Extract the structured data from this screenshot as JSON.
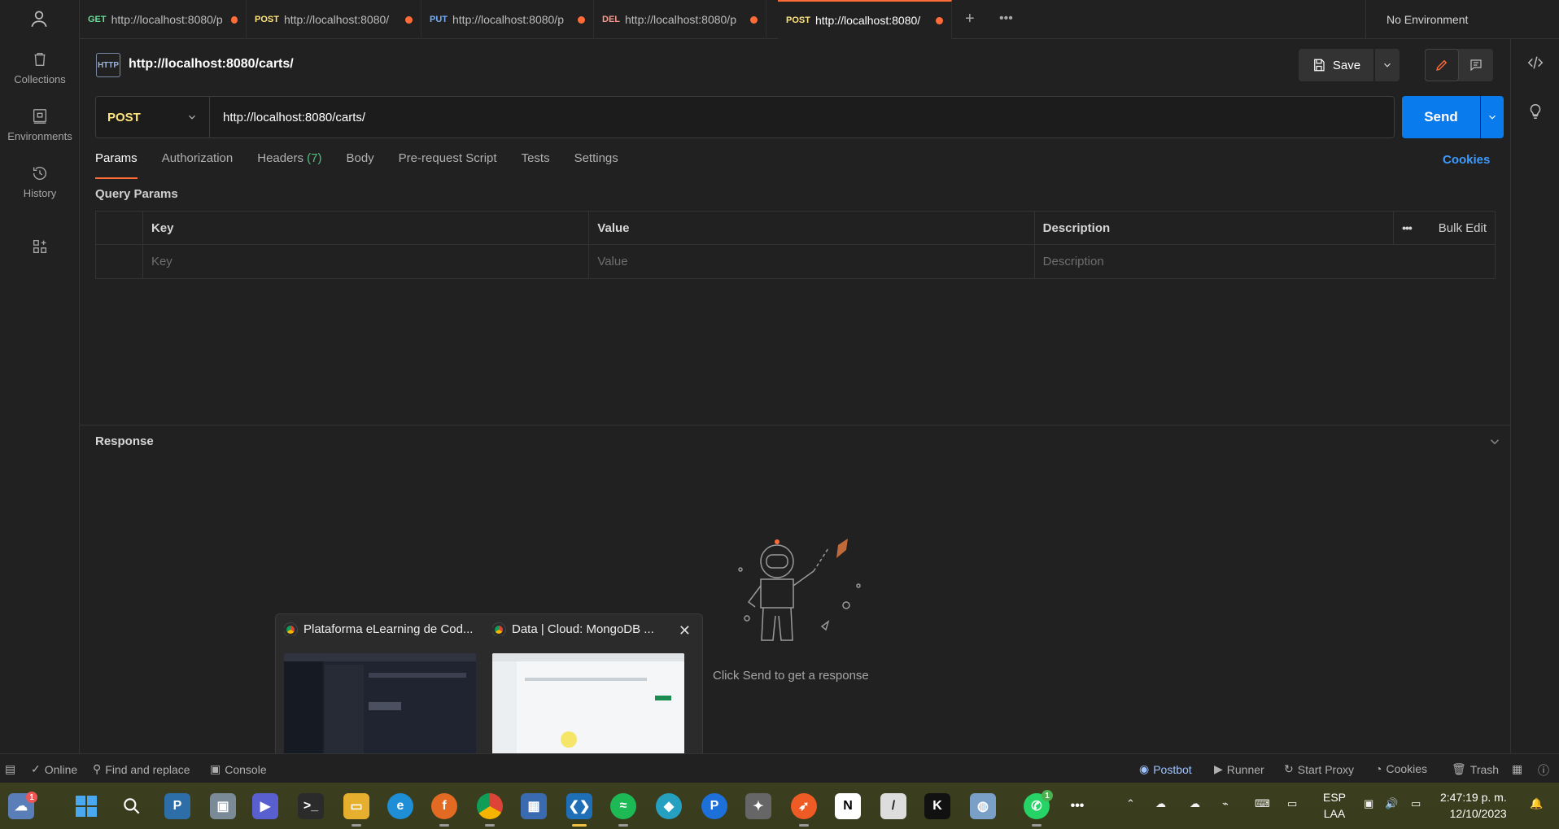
{
  "colors": {
    "accent": "#ff6c37",
    "send": "#097bed",
    "post": "#ffe47e",
    "get": "#6bdd9a",
    "put": "#74aef6",
    "del": "#f79a8e"
  },
  "sidebar": {
    "items": [
      {
        "label": "Collections",
        "icon": "trash-can-icon"
      },
      {
        "label": "Environments",
        "icon": "environment-icon"
      },
      {
        "label": "History",
        "icon": "history-icon"
      }
    ]
  },
  "tabs": [
    {
      "method": "GET",
      "url": "http://localhost:8080/p"
    },
    {
      "method": "POST",
      "url": "http://localhost:8080/"
    },
    {
      "method": "PUT",
      "url": "http://localhost:8080/p"
    },
    {
      "method": "DEL",
      "url": "http://localhost:8080/p"
    },
    {
      "method": "POST",
      "url": "http://localhost:8080/"
    }
  ],
  "environment": "No Environment",
  "request": {
    "title": "http://localhost:8080/carts/",
    "http_badge": "HTTP",
    "save_label": "Save",
    "method": "POST",
    "url": "http://localhost:8080/carts/",
    "send_label": "Send",
    "subtabs": {
      "params": "Params",
      "authorization": "Authorization",
      "headers": "Headers",
      "headers_count": "(7)",
      "body": "Body",
      "prerequest": "Pre-request Script",
      "tests": "Tests",
      "settings": "Settings"
    },
    "cookies_label": "Cookies",
    "query_params_label": "Query Params",
    "table": {
      "headers": {
        "key": "Key",
        "value": "Value",
        "description": "Description",
        "bulk_edit": "Bulk Edit"
      },
      "placeholders": {
        "key": "Key",
        "value": "Value",
        "description": "Description"
      }
    }
  },
  "response": {
    "title": "Response",
    "hint": "Click Send to get a response"
  },
  "popup": {
    "windows": [
      {
        "title": "Plataforma eLearning de Cod..."
      },
      {
        "title": "Data | Cloud: MongoDB ..."
      }
    ]
  },
  "statusbar": {
    "online": "Online",
    "find_replace": "Find and replace",
    "console": "Console",
    "postbot": "Postbot",
    "runner": "Runner",
    "start_proxy": "Start Proxy",
    "cookies": "Cookies",
    "trash": "Trash"
  },
  "taskbar": {
    "weather_badge": "1",
    "whatsapp_badge": "1",
    "lang_top": "ESP",
    "lang_bottom": "LAA",
    "time": "2:47:19 p. m.",
    "date": "12/10/2023"
  }
}
